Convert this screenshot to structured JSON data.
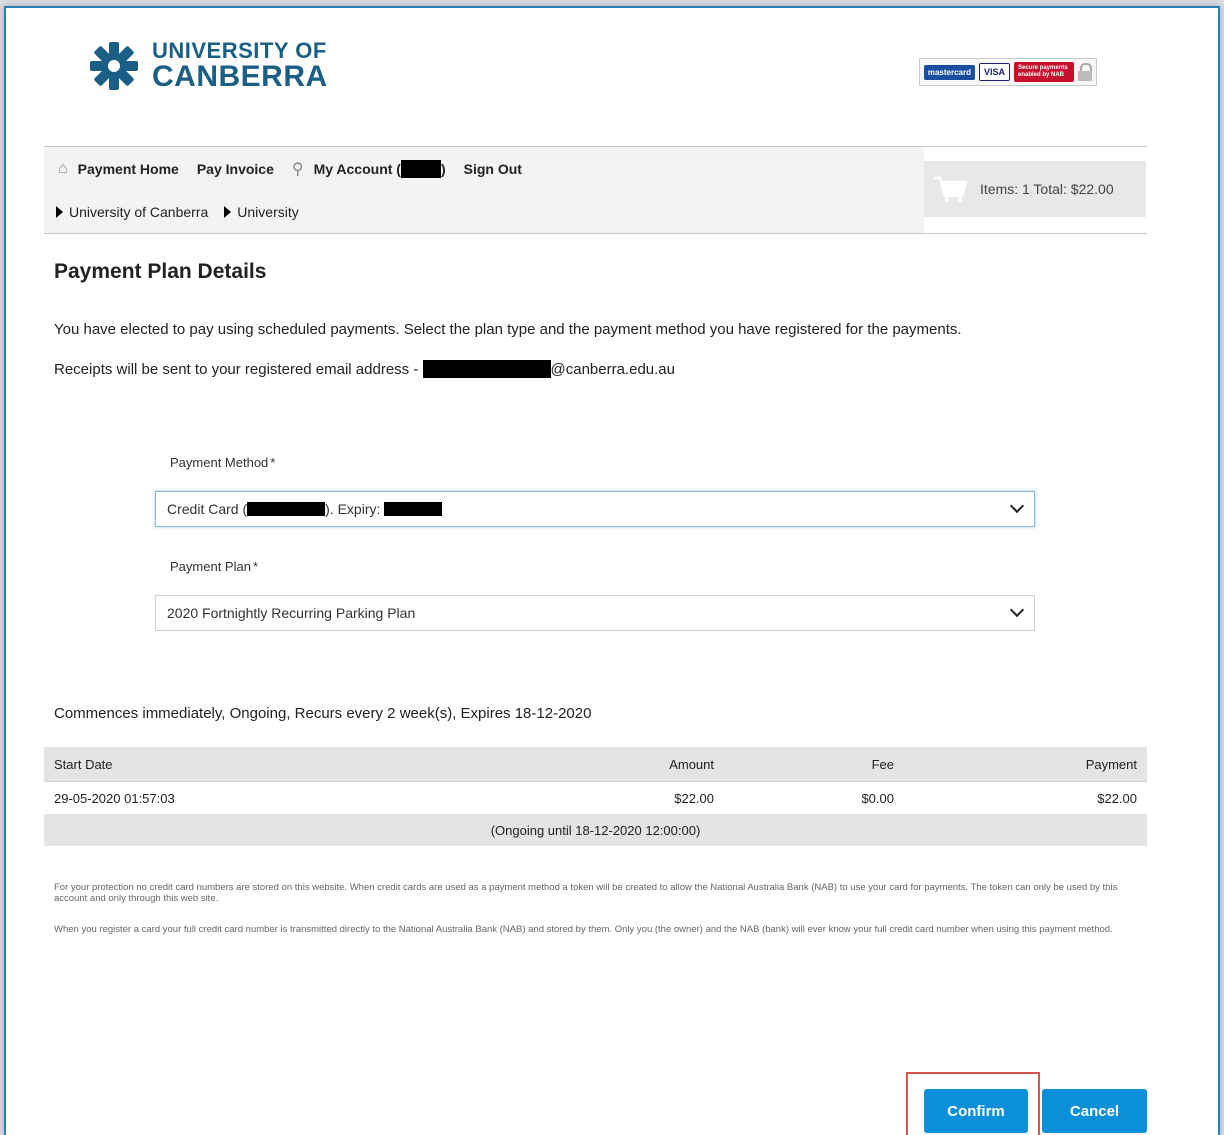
{
  "logo": {
    "line1": "UNIVERSITY OF",
    "line2": "CANBERRA"
  },
  "card_badges": {
    "mastercard": "mastercard",
    "visa": "VISA",
    "nab": "Secure payments enabled by NAB"
  },
  "nav": {
    "home": "Payment Home",
    "pay_invoice": "Pay Invoice",
    "my_account": "My Account (",
    "my_account_suffix": ")",
    "sign_out": "Sign Out"
  },
  "breadcrumb": [
    "University of Canberra",
    "University"
  ],
  "cart": {
    "summary": "Items: 1 Total: $22.00"
  },
  "page": {
    "title": "Payment Plan Details",
    "intro": "You have elected to pay using scheduled payments. Select the plan type and the payment method you have registered for the payments.",
    "receipts_prefix": "Receipts will be sent to your registered email address - ",
    "receipts_suffix": "@canberra.edu.au"
  },
  "payment_method": {
    "label": "Payment Method",
    "required": "*",
    "value_prefix": "Credit Card (",
    "value_mid": "). Expiry: "
  },
  "payment_plan": {
    "label": "Payment Plan",
    "required": "*",
    "value": "2020 Fortnightly Recurring Parking Plan"
  },
  "plan_summary": "Commences immediately, Ongoing, Recurs every 2 week(s), Expires 18-12-2020",
  "schedule": {
    "headers": {
      "start": "Start Date",
      "amount": "Amount",
      "fee": "Fee",
      "payment": "Payment"
    },
    "rows": [
      {
        "start": "29-05-2020 01:57:03",
        "amount": "$22.00",
        "fee": "$0.00",
        "payment": "$22.00"
      }
    ],
    "footer": "(Ongoing until 18-12-2020 12:00:00)"
  },
  "fineprint": {
    "p1": "For your protection no credit card numbers are stored on this website. When credit cards are used as a payment method a token will be created to allow the National Australia Bank (NAB) to use your card for payments. The token can only be used by this account and only through this web site.",
    "p2": "When you register a card your full credit card number is transmitted directly to the National Australia Bank (NAB) and stored by them. Only you (the owner) and the NAB (bank) will ever know your full credit card number when using this payment method."
  },
  "buttons": {
    "confirm": "Confirm",
    "cancel": "Cancel"
  },
  "colors": {
    "brand": "#1b5f86",
    "button": "#0a90d8",
    "highlight": "#d9534f"
  }
}
